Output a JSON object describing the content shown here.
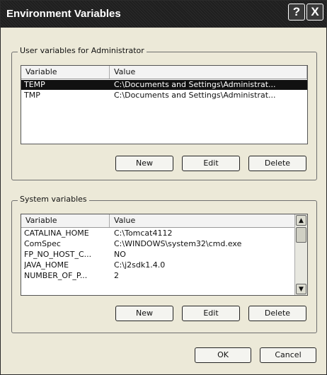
{
  "window": {
    "title": "Environment Variables",
    "help_label": "?",
    "close_label": "X"
  },
  "user_vars": {
    "group_label": "User variables for Administrator",
    "columns": [
      "Variable",
      "Value"
    ],
    "rows": [
      {
        "name": "TEMP",
        "value": "C:\\Documents and Settings\\Administrat...",
        "selected": true
      },
      {
        "name": "TMP",
        "value": "C:\\Documents and Settings\\Administrat...",
        "selected": false
      }
    ],
    "buttons": {
      "new": "New",
      "edit": "Edit",
      "delete": "Delete"
    }
  },
  "system_vars": {
    "group_label": "System variables",
    "columns": [
      "Variable",
      "Value"
    ],
    "rows": [
      {
        "name": "CATALINA_HOME",
        "value": "C:\\Tomcat4112"
      },
      {
        "name": "ComSpec",
        "value": "C:\\WINDOWS\\system32\\cmd.exe"
      },
      {
        "name": "FP_NO_HOST_C...",
        "value": "NO"
      },
      {
        "name": "JAVA_HOME",
        "value": "C:\\j2sdk1.4.0"
      },
      {
        "name": "NUMBER_OF_P...",
        "value": "2"
      }
    ],
    "buttons": {
      "new": "New",
      "edit": "Edit",
      "delete": "Delete"
    }
  },
  "footer": {
    "ok": "OK",
    "cancel": "Cancel"
  },
  "icons": {
    "scroll_up": "chevron-up-icon",
    "scroll_down": "chevron-down-icon"
  }
}
